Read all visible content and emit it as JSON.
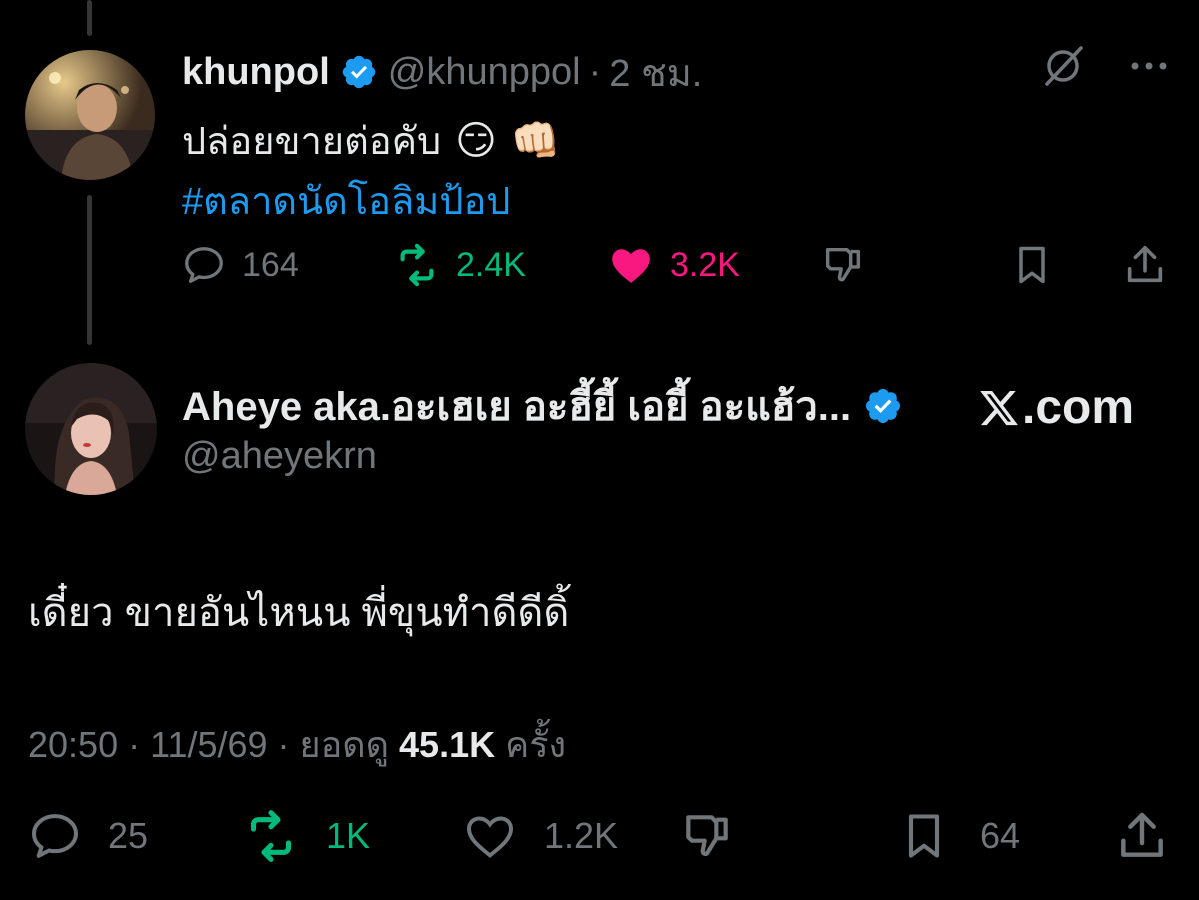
{
  "parent_tweet": {
    "author_name": "khunpol",
    "handle": "@khunppol",
    "separator": "·",
    "time": "2 ชม.",
    "text": "ปล่อยขายต่อคับ",
    "emojis": [
      "😏",
      "👊🏻"
    ],
    "hashtag": "#ตลาดนัดโอลิมป้อป",
    "actions": {
      "replies": "164",
      "reposts": "2.4K",
      "likes": "3.2K"
    }
  },
  "reply_tweet": {
    "author_name": "Aheye aka.อะเฮเย อะฮี้ยี้ เอยี้ อะแฮ้ว...",
    "handle": "@aheyekrn",
    "source_badge": ".com",
    "text": "เดี๋ยว ขายอันไหนน พี่ขุนทำดีดีดิ้",
    "meta": {
      "time": "20:50",
      "sep1": "·",
      "date": "11/5/69",
      "sep2": "·",
      "views_prefix": "ยอดดู",
      "views": "45.1K",
      "views_suffix": "ครั้ง"
    },
    "actions": {
      "replies": "25",
      "reposts": "1K",
      "likes": "1.2K",
      "bookmarks": "64"
    }
  },
  "colors": {
    "background": "#000000",
    "text": "#e7e9ea",
    "muted": "#71767b",
    "link": "#1d9bf0",
    "repost": "#00ba7c",
    "like": "#f91880",
    "verified": "#1d9bf0"
  },
  "icons": [
    "verified-badge-icon",
    "grok-slash-icon",
    "more-icon",
    "reply-icon",
    "repost-icon",
    "like-icon",
    "dislike-icon",
    "bookmark-icon",
    "share-icon",
    "x-logo-icon"
  ]
}
